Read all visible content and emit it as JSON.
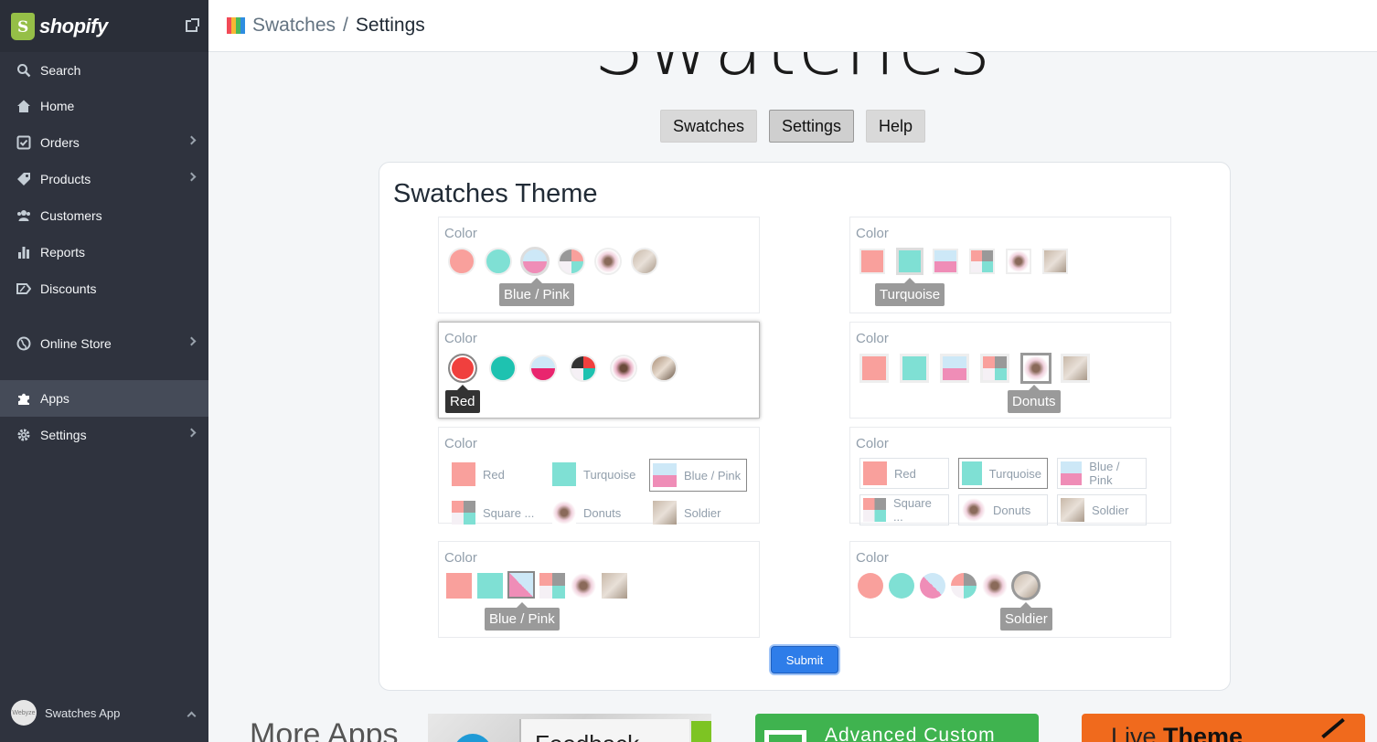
{
  "sidebar": {
    "brand": "shopify",
    "items": [
      {
        "label": "Search",
        "icon": "search-icon"
      },
      {
        "label": "Home",
        "icon": "home-icon"
      },
      {
        "label": "Orders",
        "icon": "orders-icon"
      },
      {
        "label": "Products",
        "icon": "tag-icon"
      },
      {
        "label": "Customers",
        "icon": "customers-icon"
      },
      {
        "label": "Reports",
        "icon": "reports-icon"
      },
      {
        "label": "Discounts",
        "icon": "discounts-icon"
      },
      {
        "label": "Online Store",
        "icon": "globe-icon"
      },
      {
        "label": "Apps",
        "icon": "puzzle-icon"
      },
      {
        "label": "Settings",
        "icon": "gear-icon"
      }
    ],
    "app_avatar": "Webyze",
    "app_name": "Swatches App"
  },
  "header": {
    "breadcrumb_parent": "Swatches",
    "separator": "/",
    "breadcrumb_current": "Settings"
  },
  "main": {
    "big_title": "Swatches",
    "tabs": [
      "Swatches",
      "Settings",
      "Help"
    ],
    "active_tab": "Settings",
    "card_title": "Swatches Theme",
    "option_label": "Color",
    "swatch_names": [
      "Red",
      "Turquoise",
      "Blue / Pink",
      "Square ...",
      "Donuts",
      "Soldier"
    ],
    "tooltips": {
      "theme1": "Blue / Pink",
      "theme2": "Turquoise",
      "theme3": "Red",
      "theme4": "Donuts",
      "theme7": "Blue / Pink",
      "theme8": "Soldier"
    },
    "submit_label": "Submit"
  },
  "colors": {
    "red_light": "#f9a09c",
    "red": "#f0403e",
    "turquoise_light": "#7fe0d4",
    "turquoise": "#1ec2b0",
    "blue_light": "#cde8f7",
    "pink": "#ef8db7",
    "accent_blue": "#2e7de9"
  },
  "footer": {
    "more_apps": "More Apps",
    "promo1": "Feedback",
    "promo2": "Advanced Custom",
    "promo3_prefix": "Live ",
    "promo3_bold": "Theme"
  }
}
